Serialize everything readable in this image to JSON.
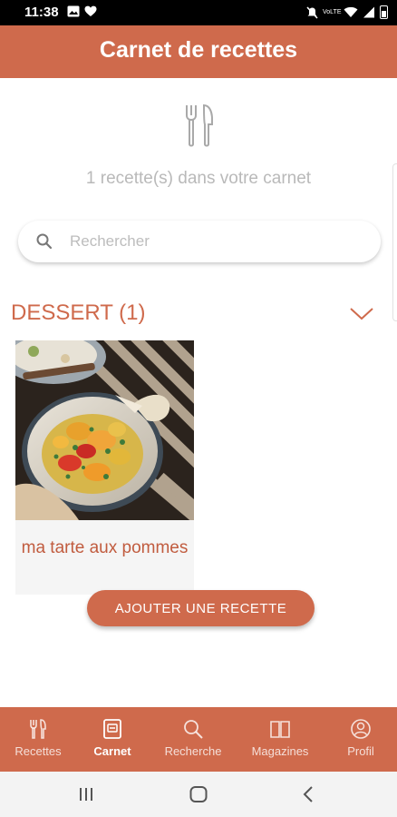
{
  "status_bar": {
    "time": "11:38",
    "left_icons": [
      "image-icon",
      "heart-icon"
    ],
    "right_icons": [
      "mute-icon",
      "vowifi-icon",
      "wifi-icon",
      "signal-icon",
      "battery-icon"
    ],
    "vowifi_label": "VoLTE"
  },
  "header": {
    "title": "Carnet de recettes"
  },
  "summary": {
    "count_text": "1 recette(s) dans votre carnet"
  },
  "search": {
    "placeholder": "Rechercher",
    "value": ""
  },
  "categories": [
    {
      "title": "DESSERT (1)",
      "recipes": [
        {
          "name": "ma tarte aux pommes"
        }
      ]
    }
  ],
  "actions": {
    "add_recipe_label": "AJOUTER UNE RECETTE"
  },
  "bottom_nav": {
    "items": [
      {
        "label": "Recettes",
        "icon": "cutlery-icon",
        "active": false
      },
      {
        "label": "Carnet",
        "icon": "notebook-icon",
        "active": true
      },
      {
        "label": "Recherche",
        "icon": "search-icon",
        "active": false
      },
      {
        "label": "Magazines",
        "icon": "book-icon",
        "active": false
      },
      {
        "label": "Profil",
        "icon": "user-icon",
        "active": false
      }
    ]
  },
  "system_nav": {
    "buttons": [
      "recents-icon",
      "home-icon",
      "back-icon"
    ]
  },
  "colors": {
    "accent": "#cf6a4c",
    "accent_text": "#c15c3f",
    "muted_text": "#b9b9b9",
    "status_bar": "#000000",
    "system_nav": "#f3f3f3"
  }
}
